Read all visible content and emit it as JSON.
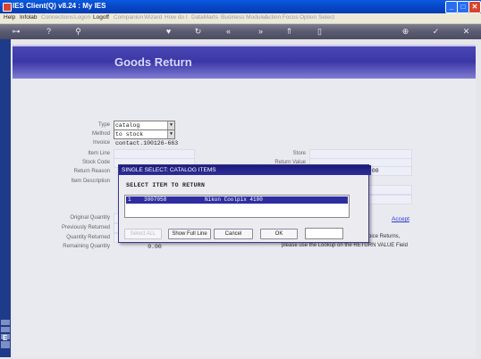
{
  "window": {
    "title": "IES Client(Q) v8.24 : My IES"
  },
  "menu": {
    "items": [
      {
        "label": "Help",
        "enabled": true
      },
      {
        "label": "Infolab",
        "enabled": true
      },
      {
        "label": "Connections",
        "enabled": false
      },
      {
        "label": "Logon",
        "enabled": false
      },
      {
        "label": "Logoff",
        "enabled": true
      },
      {
        "label": "Companion",
        "enabled": false
      },
      {
        "label": "Wizard",
        "enabled": false
      },
      {
        "label": "How do I",
        "enabled": false
      },
      {
        "label": "DataMarts",
        "enabled": false
      },
      {
        "label": "Business Modules",
        "enabled": false
      },
      {
        "label": "Action Focus",
        "enabled": false
      },
      {
        "label": "Option Select",
        "enabled": false
      }
    ]
  },
  "toolbar": {
    "icons": [
      "key-icon",
      "help-icon",
      "search-icon",
      "heart-icon",
      "refresh-icon",
      "rewind-icon",
      "fast-forward-icon",
      "upload-icon",
      "document-icon",
      "plus-circle-icon",
      "check-circle-icon",
      "close-icon"
    ]
  },
  "page": {
    "title": "Goods Return"
  },
  "form": {
    "type": {
      "label": "Type",
      "value": "catalog"
    },
    "method": {
      "label": "Method",
      "value": "to stock"
    },
    "invoice": {
      "label": "Invoice",
      "value": "contact.100126-663"
    },
    "item_line": {
      "label": "Item Line"
    },
    "stock_code": {
      "label": "Stock Code"
    },
    "return_reason": {
      "label": "Return Reason"
    },
    "item_description": {
      "label": "Item Description"
    },
    "original_quantity": {
      "label": "Original Quantity"
    },
    "previously_returned": {
      "label": "Previously Returned"
    },
    "quantity_returned": {
      "label": "Quantity Returned"
    },
    "remaining_quantity": {
      "label": "Remaining Quantity",
      "value": "0.00"
    },
    "store": {
      "label": "Store"
    },
    "return_value": {
      "label": "Return Value",
      "value": ".00"
    },
    "accept": "Accept",
    "note_line1": "oice Returns,",
    "note_line2": "please use the Lookup on the RETURN VALUE Field"
  },
  "modal": {
    "title": "SINGLE SELECT: CATALOG ITEMS",
    "heading": "SELECT ITEM TO RETURN",
    "rows": [
      {
        "num": "1",
        "code": "3007058",
        "desc": "Nikon Coolpix 4100"
      }
    ],
    "buttons": {
      "select_all": "Select ALL",
      "show_full_line": "Show Full Line",
      "cancel": "Cancel",
      "ok": "OK"
    }
  },
  "colors": {
    "title_bar": "#0747c8",
    "header": "#3b37a6",
    "selection": "#2e2ea0",
    "link": "#2a3bd0"
  }
}
